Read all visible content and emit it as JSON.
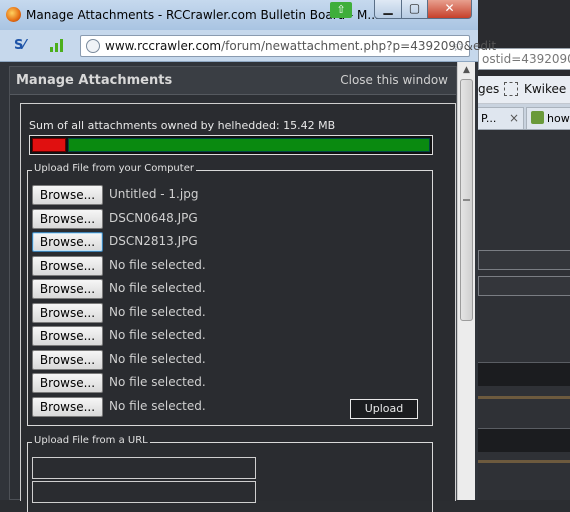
{
  "background_window": {
    "url_fragment": "ostid=4392090",
    "bookmarks": [
      "ges",
      "Kwikee"
    ],
    "tabs": [
      {
        "label": "P..."
      },
      {
        "label": "how r"
      }
    ]
  },
  "window": {
    "title": "Manage Attachments - RCCrawler.com Bulletin Board - M... Fi...",
    "buttons": {
      "minimize": "▁",
      "maximize": "▢",
      "close": "✕"
    }
  },
  "navbar": {
    "url_host": "www.rccrawler.com",
    "url_path": "/forum/newattachment.php?p=4392090&edit"
  },
  "panel": {
    "title": "Manage Attachments",
    "close_link": "Close this window",
    "sum_text": "Sum of all attachments owned by helhedded: 15.42 MB",
    "quota_used_fraction": 0.085
  },
  "upload_computer": {
    "legend": "Upload File from your Computer",
    "browse_label": "Browse...",
    "files": [
      "Untitled - 1.jpg",
      "DSCN0648.JPG",
      "DSCN2813.JPG",
      "No file selected.",
      "No file selected.",
      "No file selected.",
      "No file selected.",
      "No file selected.",
      "No file selected.",
      "No file selected."
    ],
    "upload_label": "Upload"
  },
  "upload_url": {
    "legend": "Upload File from a URL",
    "fields": [
      "",
      ""
    ]
  },
  "colors": {
    "quota_used": "#e01010",
    "quota_free": "#0a8a10"
  }
}
